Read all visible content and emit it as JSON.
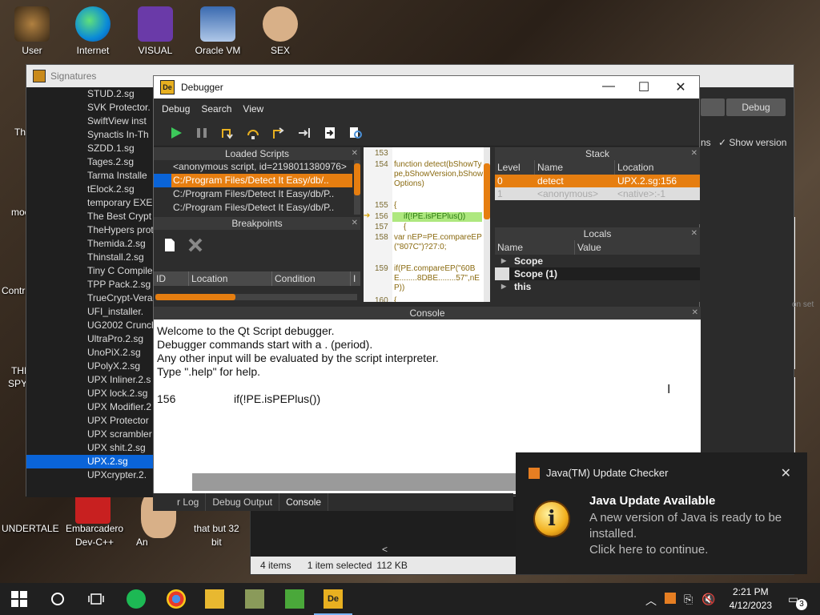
{
  "desktop": {
    "top_icons": [
      "User",
      "Internet",
      "VISUAL",
      "Oracle VM",
      "SEX"
    ],
    "left_labels": [
      "Th",
      "moo",
      "Contr",
      "THI",
      "SPY"
    ],
    "bottom_icons": [
      "UNDERTALE",
      "Embarcadero",
      "Dev-C++",
      "An",
      "that but 32",
      "bit"
    ]
  },
  "signatures": {
    "title": "Signatures",
    "items": [
      "STUD.2.sg",
      "SVK Protector.",
      "SwiftView inst",
      "Synactis In-Th",
      "SZDD.1.sg",
      "Tages.2.sg",
      "Tarma Installe",
      "tElock.2.sg",
      "temporary EXE",
      "The Best Crypt",
      "TheHypers prot",
      "Themida.2.sg",
      "Thinstall.2.sg",
      "Tiny C Compiler",
      "TPP Pack.2.sg",
      "TrueCrypt-Vera",
      "UFI_installer.",
      "UG2002 Crunch",
      "UltraPro.2.sg",
      "UnoPiX.2.sg",
      "UPolyX.2.sg",
      "UPX Inliner.2.s",
      "UPX lock.2.sg",
      "UPX Modifier.2",
      "UPX Protector",
      "UPX scrambler",
      "UPX shit.2.sg",
      "UPX.2.sg",
      "UPXcrypter.2."
    ],
    "selected_index": 27,
    "debug_button": "Debug",
    "ns_label": "ns",
    "show_version": "Show version",
    "set_label": "on set"
  },
  "explorer": {
    "status_items": "4 items",
    "status_selected": "1 item selected",
    "status_size": "112 KB",
    "min_icon": "—",
    "max_icon": "☐",
    "close_icon": "✕"
  },
  "debugger": {
    "title": "Debugger",
    "menu": [
      "Debug",
      "Search",
      "View"
    ],
    "loaded_scripts_title": "Loaded Scripts",
    "loaded_scripts": [
      "<anonymous script, id=2198011380976>",
      "C:/Program Files/Detect It Easy/db/..",
      "C:/Program Files/Detect It Easy/db/P..",
      "C:/Program Files/Detect It Easy/db/P.."
    ],
    "selected_script": 2,
    "breakpoints_title": "Breakpoints",
    "bp_columns": [
      "ID",
      "Location",
      "Condition",
      "I"
    ],
    "code_lines": [
      {
        "n": "153",
        "text": ""
      },
      {
        "n": "154",
        "text": "function detect(bShowType,bShowVersion,bShowOptions)"
      },
      {
        "n": "155",
        "text": "{"
      },
      {
        "n": "156",
        "text": "if(!PE.isPEPlus())"
      },
      {
        "n": "157",
        "text": "{"
      },
      {
        "n": "158",
        "text": "var nEP=PE.compareEP(\"807C\")?27:0;"
      },
      {
        "n": "159",
        "text": "if(PE.compareEP(\"60BE........8DBE........57\",nEP))"
      },
      {
        "n": "160",
        "text": "{"
      }
    ],
    "stack_title": "Stack",
    "stack_columns": [
      "Level",
      "Name",
      "Location"
    ],
    "stack_rows": [
      {
        "level": "0",
        "name": "detect",
        "location": "UPX.2.sg:156"
      },
      {
        "level": "1",
        "name": "<anonymous>",
        "location": "<native>:-1"
      }
    ],
    "locals_title": "Locals",
    "locals_columns": [
      "Name",
      "Value"
    ],
    "locals_rows": [
      "Scope",
      "Scope (1)",
      "this"
    ],
    "console_title": "Console",
    "console_lines": [
      "Welcome to the Qt Script debugger.",
      "Debugger commands start with a . (period).",
      "Any other input will be evaluated by the script interpreter.",
      "Type \".help\" for help."
    ],
    "console_line_no": "156",
    "console_code": "if(!PE.isPEPlus())",
    "min_icon": "—",
    "max_icon": "☐",
    "close_icon": "✕"
  },
  "bottom_tabs": [
    "r Log",
    "Debug Output",
    "Console"
  ],
  "notification": {
    "app": "Java(TM) Update Checker",
    "title": "Java Update Available",
    "body": "A new version of Java is ready to be installed.",
    "action": "Click here to continue."
  },
  "taskbar": {
    "time": "2:21 PM",
    "date": "4/12/2023",
    "notif_count": "3"
  },
  "colors": {
    "accent": "#e67e10",
    "select_blue": "#0a64d8"
  }
}
